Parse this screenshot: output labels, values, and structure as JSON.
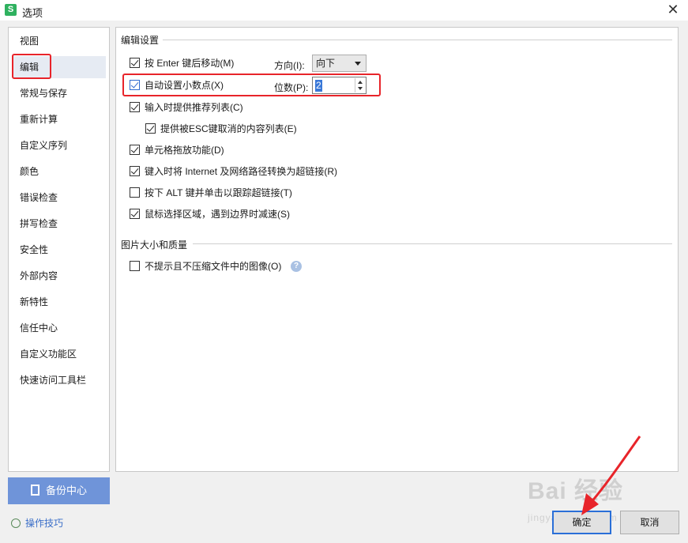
{
  "window": {
    "title": "选项",
    "app_icon_letter": "S",
    "close_glyph": "✕"
  },
  "sidebar": {
    "items": [
      {
        "label": "视图"
      },
      {
        "label": "编辑"
      },
      {
        "label": "常规与保存"
      },
      {
        "label": "重新计算"
      },
      {
        "label": "自定义序列"
      },
      {
        "label": "颜色"
      },
      {
        "label": "错误检查"
      },
      {
        "label": "拼写检查"
      },
      {
        "label": "安全性"
      },
      {
        "label": "外部内容"
      },
      {
        "label": "新特性"
      },
      {
        "label": "信任中心"
      },
      {
        "label": "自定义功能区"
      },
      {
        "label": "快速访问工具栏"
      }
    ],
    "active_index": 1,
    "backup_label": "备份中心",
    "tips_label": "操作技巧"
  },
  "edit_settings": {
    "section_title": "编辑设置",
    "options": [
      {
        "label": "按 Enter 键后移动(M)",
        "checked": true
      },
      {
        "label": "自动设置小数点(X)",
        "checked": true
      },
      {
        "label": "输入时提供推荐列表(C)",
        "checked": true
      },
      {
        "label": "提供被ESC键取消的内容列表(E)",
        "checked": true
      },
      {
        "label": "单元格拖放功能(D)",
        "checked": true
      },
      {
        "label": "键入时将 Internet 及网络路径转换为超链接(R)",
        "checked": true
      },
      {
        "label": "按下 ALT 键并单击以跟踪超链接(T)",
        "checked": false
      },
      {
        "label": "鼠标选择区域，遇到边界时减速(S)",
        "checked": true
      }
    ],
    "direction_label": "方向(I):",
    "direction_value": "向下",
    "digits_label": "位数(P):",
    "digits_value": "2"
  },
  "image_settings": {
    "section_title": "图片大小和质量",
    "options": [
      {
        "label": "不提示且不压缩文件中的图像(O)",
        "checked": false
      }
    ],
    "help_glyph": "?"
  },
  "buttons": {
    "ok": "确定",
    "cancel": "取消"
  },
  "watermark": {
    "main": "Bai 经验",
    "sub": "jingyan.baidu.com"
  },
  "colors": {
    "highlight_red": "#e8242a",
    "accent_blue": "#2a6fd8",
    "backup_bg": "#6f94d9"
  }
}
